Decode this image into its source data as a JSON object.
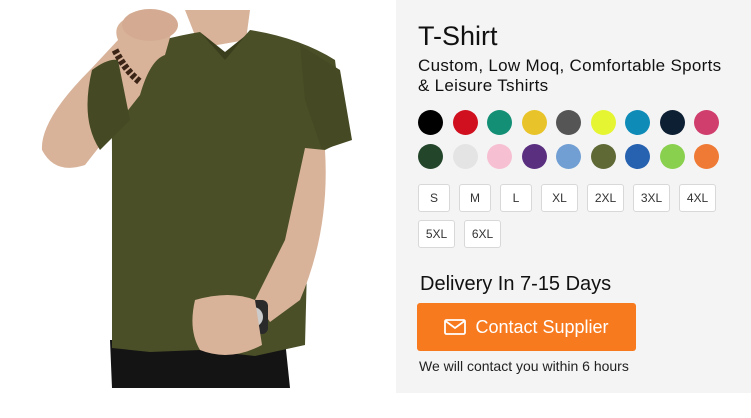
{
  "product": {
    "title": "T-Shirt",
    "subtitle": "Custom,  Low Moq,  Comfortable Sports & Leisure Tshirts"
  },
  "colors": [
    "#000000",
    "#d0101e",
    "#138f76",
    "#e8c42a",
    "#555555",
    "#e6f531",
    "#0f8bb8",
    "#0d1f33",
    "#cf3e6c",
    "#23452a",
    "#e4e4e4",
    "#f7bfd2",
    "#5a2f80",
    "#719fd3",
    "#5e6935",
    "#2762b0",
    "#8ad04f",
    "#ef7a35"
  ],
  "sizes": [
    "S",
    "M",
    "L",
    "XL",
    "2XL",
    "3XL",
    "4XL",
    "5XL",
    "6XL"
  ],
  "delivery": "Delivery In 7-15 Days",
  "contact_button": {
    "label": "Contact Supplier",
    "icon": "mail-icon",
    "color": "#f77a1e"
  },
  "contact_note": "We will contact you within 6 hours",
  "image": {
    "subject": "olive-tshirt-photo",
    "shirt_color": "#4a4f27"
  }
}
